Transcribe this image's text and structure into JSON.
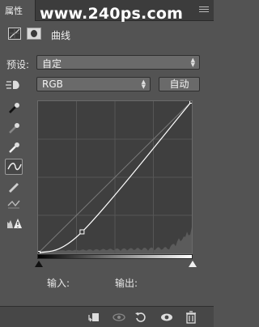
{
  "tabbar": {
    "tab_label": "属性",
    "watermark": "www.240ps.com"
  },
  "adjustment": {
    "title": "曲线"
  },
  "preset": {
    "label": "预设:",
    "value": "自定"
  },
  "channel": {
    "value": "RGB",
    "auto_label": "自动"
  },
  "io": {
    "input_label": "输入:",
    "output_label": "输出:"
  },
  "curve": {
    "points": [
      [
        0,
        0
      ],
      [
        73,
        36
      ],
      [
        255,
        255
      ]
    ]
  },
  "icons": {
    "tools": [
      "on-image-adjust-icon",
      "sample-black-point-icon",
      "sample-gray-point-icon",
      "sample-white-point-icon",
      "curve-edit-icon",
      "pencil-icon",
      "smooth-icon",
      "clipping-warning-icon"
    ],
    "bottom": [
      "clip-to-layer-icon",
      "view-previous-icon",
      "reset-icon",
      "visibility-icon",
      "trash-icon"
    ]
  },
  "colors": {
    "panel_bg": "#535353",
    "graph_bg": "#3f3f3f",
    "curve": "#ffffff"
  }
}
